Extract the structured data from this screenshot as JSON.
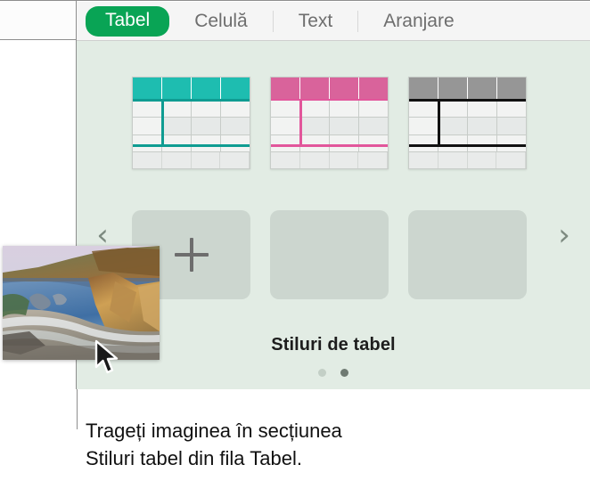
{
  "inspector": {
    "tabs": [
      {
        "label": "Tabel",
        "selected": true
      },
      {
        "label": "Celulă",
        "selected": false
      },
      {
        "label": "Text",
        "selected": false
      },
      {
        "label": "Aranjare",
        "selected": false
      }
    ],
    "accent_color": "#09a455",
    "panel_background": "#e2ece4",
    "section_label": "Stiluri de tabel",
    "nav": {
      "prev_icon": "chevron-left-icon",
      "prev_glyph": "‹",
      "next_icon": "chevron-right-icon",
      "next_glyph": "›"
    },
    "table_styles": [
      {
        "name": "teal-table-style",
        "header_color": "#1ebdb0",
        "rule_color": "#0f9c92"
      },
      {
        "name": "pink-table-style",
        "header_color": "#d9639b",
        "rule_color": "#e2569b"
      },
      {
        "name": "gray-table-style",
        "header_color": "#969696",
        "rule_color": "#111111"
      }
    ],
    "placeholders": [
      {
        "name": "add-table-style-tile",
        "icon": "plus-icon",
        "has_plus": true
      },
      {
        "name": "empty-style-tile-2",
        "has_plus": false
      },
      {
        "name": "empty-style-tile-3",
        "has_plus": false
      }
    ],
    "pagination": {
      "total": 2,
      "active_index": 1
    }
  },
  "drag": {
    "image_alt": "coastal-photo-thumbnail",
    "cursor_icon": "arrow-cursor"
  },
  "callout": {
    "line1": "Trageți imaginea în secțiunea",
    "line2": "Stiluri tabel din fila Tabel."
  }
}
